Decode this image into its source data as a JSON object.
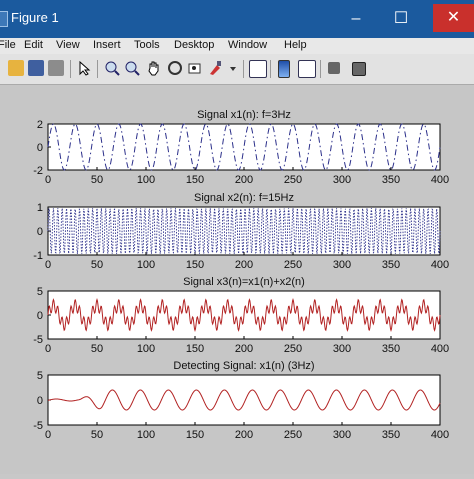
{
  "window": {
    "title": "Figure 1",
    "minimize_glyph": "–",
    "maximize_glyph": "☐",
    "close_glyph": "✕"
  },
  "menu": [
    "File",
    "Edit",
    "View",
    "Insert",
    "Tools",
    "Desktop",
    "Window",
    "Help"
  ],
  "toolbar_icons": [
    "open-folder-icon",
    "save-icon",
    "print-icon",
    "arrow-pointer-icon",
    "zoom-in-icon",
    "zoom-out-icon",
    "pan-hand-icon",
    "rotate-3d-icon",
    "data-cursor-icon",
    "brush-icon",
    "link-plot-icon",
    "colorbar-icon",
    "legend-icon",
    "hide-plot-tools-icon",
    "show-plot-tools-icon"
  ],
  "subplots": [
    {
      "title": "Signal x1(n): f=3Hz",
      "yticks": [
        "2",
        "0",
        "-2"
      ],
      "xticks": [
        "0",
        "50",
        "100",
        "150",
        "200",
        "250",
        "300",
        "350",
        "400"
      ],
      "color": "#2b2f8a",
      "style": "dashdot",
      "chart_data": {
        "type": "line",
        "xlim": [
          0,
          400
        ],
        "ylim": [
          -2,
          2
        ],
        "description_values": {
          "amplitude": 2,
          "cycles_in_400": 18
        }
      }
    },
    {
      "title": "Signal x2(n): f=15Hz",
      "yticks": [
        "1",
        "0",
        "-1"
      ],
      "xticks": [
        "0",
        "50",
        "100",
        "150",
        "200",
        "250",
        "300",
        "350",
        "400"
      ],
      "color": "#2b2f8a",
      "style": "dotted",
      "chart_data": {
        "type": "line",
        "xlim": [
          0,
          400
        ],
        "ylim": [
          -1,
          1
        ],
        "description_values": {
          "amplitude": 1,
          "cycles_in_400": 90
        }
      }
    },
    {
      "title": "Signal x3(n)=x1(n)+x2(n)",
      "yticks": [
        "5",
        "0",
        "-5"
      ],
      "xticks": [
        "0",
        "50",
        "100",
        "150",
        "200",
        "250",
        "300",
        "350",
        "400"
      ],
      "color": "#b22222",
      "style": "solid",
      "chart_data": {
        "type": "line",
        "xlim": [
          0,
          400
        ],
        "ylim": [
          -5,
          5
        ],
        "description_values": {
          "amplitude": 3,
          "cycles_in_400": 18
        }
      }
    },
    {
      "title": "Detecting Signal: x1(n) (3Hz)",
      "yticks": [
        "5",
        "0",
        "-5"
      ],
      "xticks": [
        "0",
        "50",
        "100",
        "150",
        "200",
        "250",
        "300",
        "350",
        "400"
      ],
      "color": "#b22222",
      "style": "solid",
      "chart_data": {
        "type": "line",
        "xlim": [
          0,
          400
        ],
        "ylim": [
          -5,
          5
        ],
        "description_values": {
          "amplitude": 2,
          "cycles_in_400": 14,
          "onset_x": 30
        }
      }
    }
  ]
}
